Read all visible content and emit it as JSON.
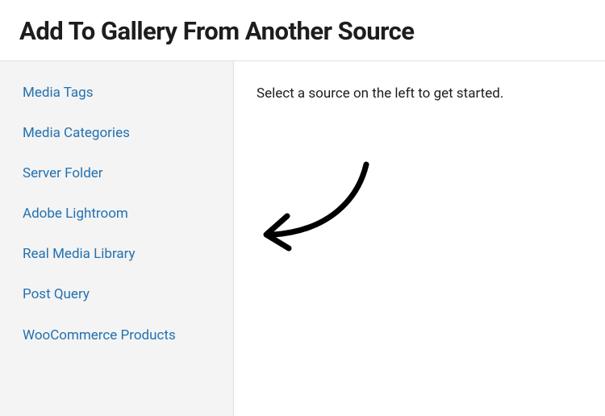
{
  "header": {
    "title": "Add To Gallery From Another Source"
  },
  "sidebar": {
    "items": [
      {
        "label": "Media Tags"
      },
      {
        "label": "Media Categories"
      },
      {
        "label": "Server Folder"
      },
      {
        "label": "Adobe Lightroom"
      },
      {
        "label": "Real Media Library"
      },
      {
        "label": "Post Query"
      },
      {
        "label": "WooCommerce Products"
      }
    ]
  },
  "main": {
    "instruction": "Select a source on the left to get started."
  }
}
